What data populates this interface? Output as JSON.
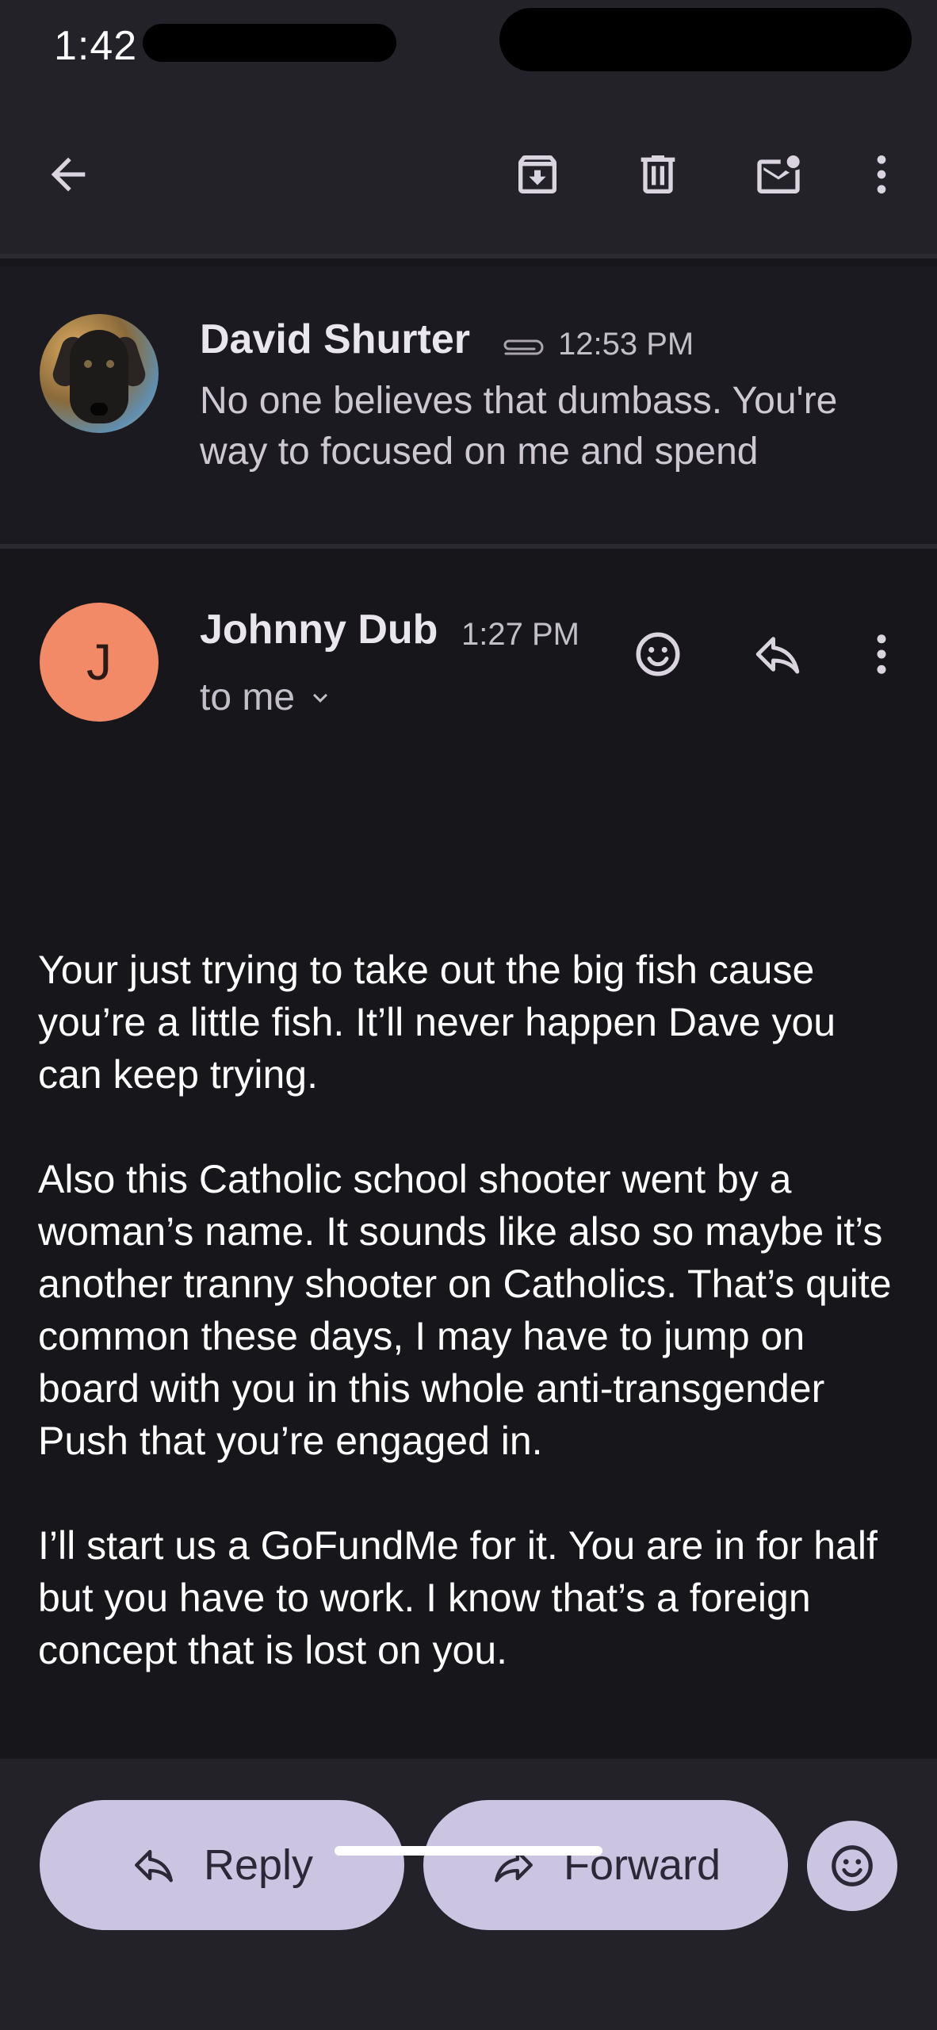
{
  "status_bar": {
    "time": "1:42"
  },
  "toolbar": {
    "back_icon": "arrow-back-icon",
    "archive_icon": "archive-icon",
    "delete_icon": "trash-icon",
    "unread_icon": "mark-unread-icon",
    "more_icon": "more-vert-icon"
  },
  "previous_message": {
    "sender": "David Shurter",
    "time": "12:53 PM",
    "snippet": "No one believes that dumbass. You're way to focused on me and spend"
  },
  "current_message": {
    "avatar_letter": "J",
    "sender": "Johnny Dub",
    "time": "1:27 PM",
    "recipient": "to me",
    "body": [
      "Your  just trying to take out the big fish cause you’re a little fish. It’ll never happen Dave you can keep trying.",
      "Also this Catholic school shooter went by a woman’s name. It sounds like also so maybe it’s another tranny shooter on Catholics. That’s quite common these days, I may have to jump on board with you in this whole anti-transgender Push that you’re engaged in.",
      "I’ll start us a GoFundMe for it. You are in for half but you have to work. I know that’s a foreign concept that is lost on you."
    ]
  },
  "actions": {
    "reply_label": "Reply",
    "forward_label": "Forward"
  },
  "colors": {
    "background": "#17161b",
    "bar": "#232229",
    "avatar": "#f38a67",
    "pill": "#ccc5e1"
  }
}
